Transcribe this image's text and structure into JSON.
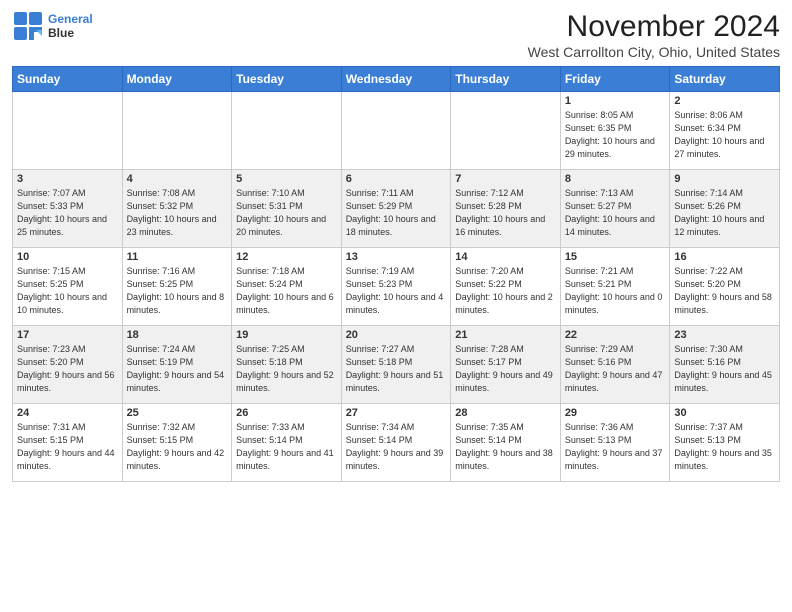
{
  "header": {
    "logo_line1": "General",
    "logo_line2": "Blue",
    "title": "November 2024",
    "subtitle": "West Carrollton City, Ohio, United States"
  },
  "weekdays": [
    "Sunday",
    "Monday",
    "Tuesday",
    "Wednesday",
    "Thursday",
    "Friday",
    "Saturday"
  ],
  "weeks": [
    [
      {
        "day": "",
        "info": ""
      },
      {
        "day": "",
        "info": ""
      },
      {
        "day": "",
        "info": ""
      },
      {
        "day": "",
        "info": ""
      },
      {
        "day": "",
        "info": ""
      },
      {
        "day": "1",
        "info": "Sunrise: 8:05 AM\nSunset: 6:35 PM\nDaylight: 10 hours and 29 minutes."
      },
      {
        "day": "2",
        "info": "Sunrise: 8:06 AM\nSunset: 6:34 PM\nDaylight: 10 hours and 27 minutes."
      }
    ],
    [
      {
        "day": "3",
        "info": "Sunrise: 7:07 AM\nSunset: 5:33 PM\nDaylight: 10 hours and 25 minutes."
      },
      {
        "day": "4",
        "info": "Sunrise: 7:08 AM\nSunset: 5:32 PM\nDaylight: 10 hours and 23 minutes."
      },
      {
        "day": "5",
        "info": "Sunrise: 7:10 AM\nSunset: 5:31 PM\nDaylight: 10 hours and 20 minutes."
      },
      {
        "day": "6",
        "info": "Sunrise: 7:11 AM\nSunset: 5:29 PM\nDaylight: 10 hours and 18 minutes."
      },
      {
        "day": "7",
        "info": "Sunrise: 7:12 AM\nSunset: 5:28 PM\nDaylight: 10 hours and 16 minutes."
      },
      {
        "day": "8",
        "info": "Sunrise: 7:13 AM\nSunset: 5:27 PM\nDaylight: 10 hours and 14 minutes."
      },
      {
        "day": "9",
        "info": "Sunrise: 7:14 AM\nSunset: 5:26 PM\nDaylight: 10 hours and 12 minutes."
      }
    ],
    [
      {
        "day": "10",
        "info": "Sunrise: 7:15 AM\nSunset: 5:25 PM\nDaylight: 10 hours and 10 minutes."
      },
      {
        "day": "11",
        "info": "Sunrise: 7:16 AM\nSunset: 5:25 PM\nDaylight: 10 hours and 8 minutes."
      },
      {
        "day": "12",
        "info": "Sunrise: 7:18 AM\nSunset: 5:24 PM\nDaylight: 10 hours and 6 minutes."
      },
      {
        "day": "13",
        "info": "Sunrise: 7:19 AM\nSunset: 5:23 PM\nDaylight: 10 hours and 4 minutes."
      },
      {
        "day": "14",
        "info": "Sunrise: 7:20 AM\nSunset: 5:22 PM\nDaylight: 10 hours and 2 minutes."
      },
      {
        "day": "15",
        "info": "Sunrise: 7:21 AM\nSunset: 5:21 PM\nDaylight: 10 hours and 0 minutes."
      },
      {
        "day": "16",
        "info": "Sunrise: 7:22 AM\nSunset: 5:20 PM\nDaylight: 9 hours and 58 minutes."
      }
    ],
    [
      {
        "day": "17",
        "info": "Sunrise: 7:23 AM\nSunset: 5:20 PM\nDaylight: 9 hours and 56 minutes."
      },
      {
        "day": "18",
        "info": "Sunrise: 7:24 AM\nSunset: 5:19 PM\nDaylight: 9 hours and 54 minutes."
      },
      {
        "day": "19",
        "info": "Sunrise: 7:25 AM\nSunset: 5:18 PM\nDaylight: 9 hours and 52 minutes."
      },
      {
        "day": "20",
        "info": "Sunrise: 7:27 AM\nSunset: 5:18 PM\nDaylight: 9 hours and 51 minutes."
      },
      {
        "day": "21",
        "info": "Sunrise: 7:28 AM\nSunset: 5:17 PM\nDaylight: 9 hours and 49 minutes."
      },
      {
        "day": "22",
        "info": "Sunrise: 7:29 AM\nSunset: 5:16 PM\nDaylight: 9 hours and 47 minutes."
      },
      {
        "day": "23",
        "info": "Sunrise: 7:30 AM\nSunset: 5:16 PM\nDaylight: 9 hours and 45 minutes."
      }
    ],
    [
      {
        "day": "24",
        "info": "Sunrise: 7:31 AM\nSunset: 5:15 PM\nDaylight: 9 hours and 44 minutes."
      },
      {
        "day": "25",
        "info": "Sunrise: 7:32 AM\nSunset: 5:15 PM\nDaylight: 9 hours and 42 minutes."
      },
      {
        "day": "26",
        "info": "Sunrise: 7:33 AM\nSunset: 5:14 PM\nDaylight: 9 hours and 41 minutes."
      },
      {
        "day": "27",
        "info": "Sunrise: 7:34 AM\nSunset: 5:14 PM\nDaylight: 9 hours and 39 minutes."
      },
      {
        "day": "28",
        "info": "Sunrise: 7:35 AM\nSunset: 5:14 PM\nDaylight: 9 hours and 38 minutes."
      },
      {
        "day": "29",
        "info": "Sunrise: 7:36 AM\nSunset: 5:13 PM\nDaylight: 9 hours and 37 minutes."
      },
      {
        "day": "30",
        "info": "Sunrise: 7:37 AM\nSunset: 5:13 PM\nDaylight: 9 hours and 35 minutes."
      }
    ]
  ]
}
